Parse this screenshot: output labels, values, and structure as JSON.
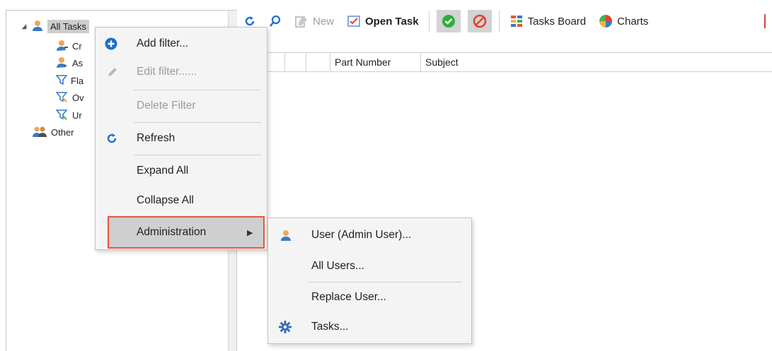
{
  "tree": {
    "root_label": "All Tasks",
    "items": [
      {
        "label": "Cr",
        "icon": "user-pen-icon"
      },
      {
        "label": "As",
        "icon": "user-assign-icon"
      },
      {
        "label": "Fla",
        "icon": "filter-icon"
      },
      {
        "label": "Ov",
        "icon": "flag-filter-icon"
      },
      {
        "label": "Ur",
        "icon": "flag-filter-icon"
      }
    ],
    "other_label": "Other"
  },
  "toolbar": {
    "new_label": "New",
    "open_task_label": "Open Task",
    "tasks_board_label": "Tasks Board",
    "charts_label": "Charts"
  },
  "grid": {
    "columns": [
      "",
      "",
      "",
      "Part Number",
      "Subject"
    ]
  },
  "context_menu": {
    "add_filter": "Add filter...",
    "edit_filter": "Edit filter......",
    "delete_filter": "Delete Filter",
    "refresh": "Refresh",
    "expand_all": "Expand All",
    "collapse_all": "Collapse All",
    "administration": "Administration"
  },
  "admin_submenu": {
    "user_admin": "User (Admin User)...",
    "all_users": "All Users...",
    "replace_user": "Replace User...",
    "tasks": "Tasks..."
  },
  "colors": {
    "accent_blue": "#1f6fcf",
    "highlight_border": "#e8553e",
    "approve_green": "#2fae3a",
    "reject_red": "#e0442f"
  }
}
